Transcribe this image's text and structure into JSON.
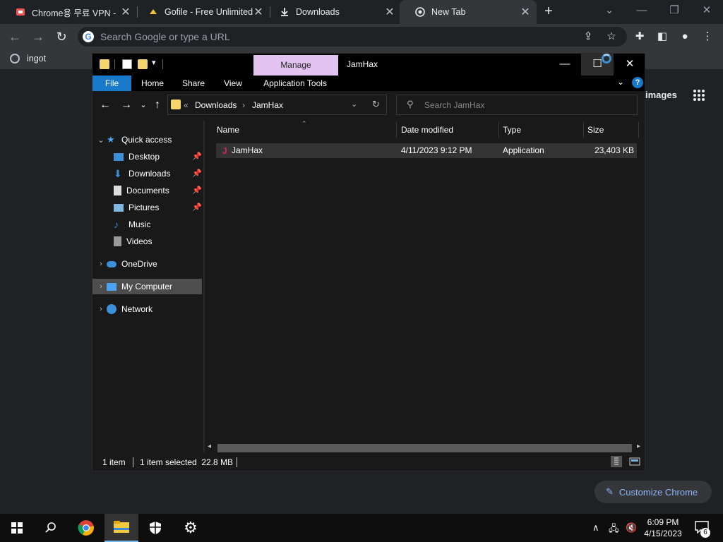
{
  "chrome": {
    "tabs": [
      {
        "label": "Chrome용 무료 VPN -",
        "icon": "chrome-vpn-icon"
      },
      {
        "label": "Gofile - Free Unlimited",
        "icon": "gofile-icon"
      },
      {
        "label": "Downloads",
        "icon": "download-icon"
      },
      {
        "label": "New Tab",
        "icon": "chrome-icon"
      }
    ],
    "omnibox_placeholder": "Search Google or type a URL",
    "bookmark": "ingot",
    "ntp_images_link": "images",
    "customize_label": "Customize Chrome"
  },
  "explorer": {
    "title": "JamHax",
    "manage_label": "Manage",
    "ribbon_tabs": [
      "File",
      "Home",
      "Share",
      "View",
      "Application Tools"
    ],
    "address": {
      "overflow": "«",
      "segments": [
        "Downloads",
        "JamHax"
      ]
    },
    "search_placeholder": "Search JamHax",
    "nav": [
      {
        "label": "Quick access"
      },
      {
        "label": "Desktop"
      },
      {
        "label": "Downloads"
      },
      {
        "label": "Documents"
      },
      {
        "label": "Pictures"
      },
      {
        "label": "Music"
      },
      {
        "label": "Videos"
      },
      {
        "label": "OneDrive"
      },
      {
        "label": "My Computer"
      },
      {
        "label": "Network"
      }
    ],
    "columns": [
      "Name",
      "Date modified",
      "Type",
      "Size"
    ],
    "files": [
      {
        "name": "JamHax",
        "date": "4/11/2023 9:12 PM",
        "type": "Application",
        "size": "23,403 KB"
      }
    ],
    "status": {
      "count": "1 item",
      "selected": "1 item selected  22.8 MB"
    }
  },
  "taskbar": {
    "time": "6:09 PM",
    "date": "4/15/2023",
    "notifications": "6"
  },
  "colors": {
    "accent": "#1979ca",
    "manage_bg": "#e3c3f0",
    "chrome_bg": "#202124",
    "toolbar_bg": "#35363a"
  }
}
